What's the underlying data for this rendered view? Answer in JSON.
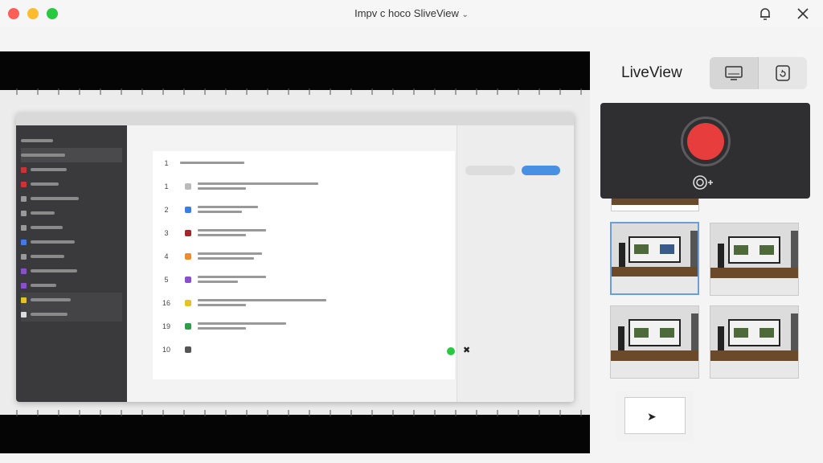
{
  "window": {
    "title": "Impv  c hoco SliveView",
    "title_icons": [
      "bell-icon",
      "close-icon"
    ]
  },
  "panel": {
    "title": "LiveView",
    "view_options": [
      "monitor-icon",
      "device-refresh-icon"
    ]
  },
  "recorder": {
    "record_button": "record-icon",
    "secondary": "camera-add-icon"
  },
  "video": {
    "rows": [
      "1",
      "1",
      "2",
      "3",
      "4",
      "5",
      "16",
      "19",
      "10"
    ]
  },
  "colors": {
    "record": "#e83d3d",
    "selection": "#6a9ed6",
    "recorder_bg": "#2f2f31"
  }
}
